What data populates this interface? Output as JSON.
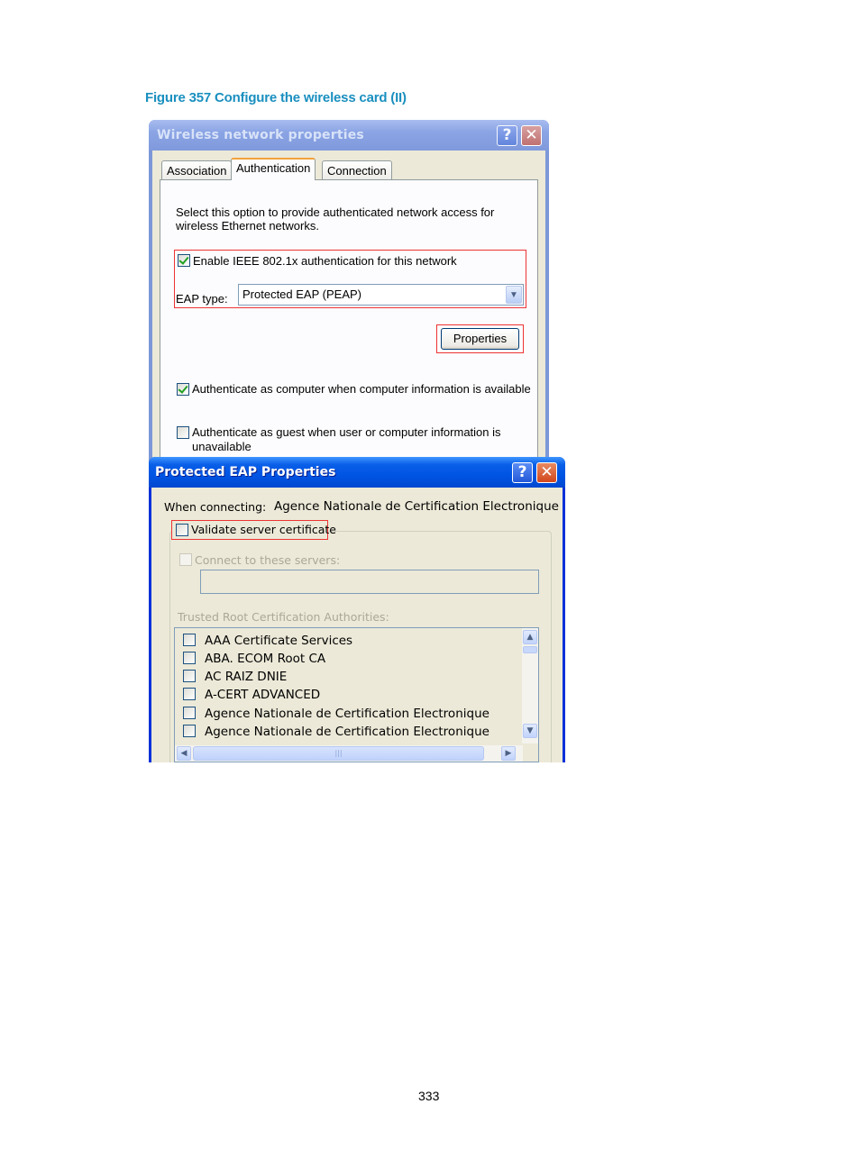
{
  "figure_caption": "Figure 357 Configure the wireless card (II)",
  "page_number": "333",
  "wireless_dialog": {
    "title": "Wireless network properties",
    "help_icon": "?",
    "close_icon": "✕",
    "tabs": [
      {
        "label": "Association",
        "active": false
      },
      {
        "label": "Authentication",
        "active": true
      },
      {
        "label": "Connection",
        "active": false
      }
    ],
    "description_line1": "Select this option to provide authenticated network access for",
    "description_line2": "wireless Ethernet networks.",
    "enable_8021x": {
      "label": "Enable IEEE 802.1x authentication for this network",
      "checked": true
    },
    "eap_type_label": "EAP type:",
    "eap_type_value": "Protected EAP (PEAP)",
    "combo_arrow": "▼",
    "properties_button": "Properties",
    "auth_as_computer": {
      "label": "Authenticate as computer when computer information is available",
      "checked": true
    },
    "auth_as_guest": {
      "label_line1": "Authenticate as guest when user or computer information is",
      "label_line2": "unavailable",
      "checked": false
    }
  },
  "peap_dialog": {
    "title": "Protected EAP Properties",
    "help_icon": "?",
    "close_icon": "✕",
    "when_connecting_label": "When connecting:",
    "when_connecting_value": "Agence Nationale de Certification Electronique",
    "validate_server_cert": {
      "label": "Validate server certificate",
      "checked": false
    },
    "connect_to_servers": {
      "label": "Connect to these servers:",
      "checked": false,
      "disabled": true,
      "value": ""
    },
    "trusted_root_label": "Trusted Root Certification Authorities:",
    "cert_list": [
      {
        "label": "AAA Certificate Services",
        "checked": false
      },
      {
        "label": "ABA. ECOM Root CA",
        "checked": false
      },
      {
        "label": "AC RAIZ DNIE",
        "checked": false
      },
      {
        "label": "A-CERT ADVANCED",
        "checked": false
      },
      {
        "label": "Agence Nationale de Certification Electronique",
        "checked": false
      },
      {
        "label": "Agence Nationale de Certification Electronique",
        "checked": false
      }
    ],
    "scroll_up_icon": "▲",
    "scroll_down_icon": "▼",
    "scroll_left_icon": "◀",
    "scroll_right_icon": "▶",
    "scroll_grip": "|||"
  }
}
